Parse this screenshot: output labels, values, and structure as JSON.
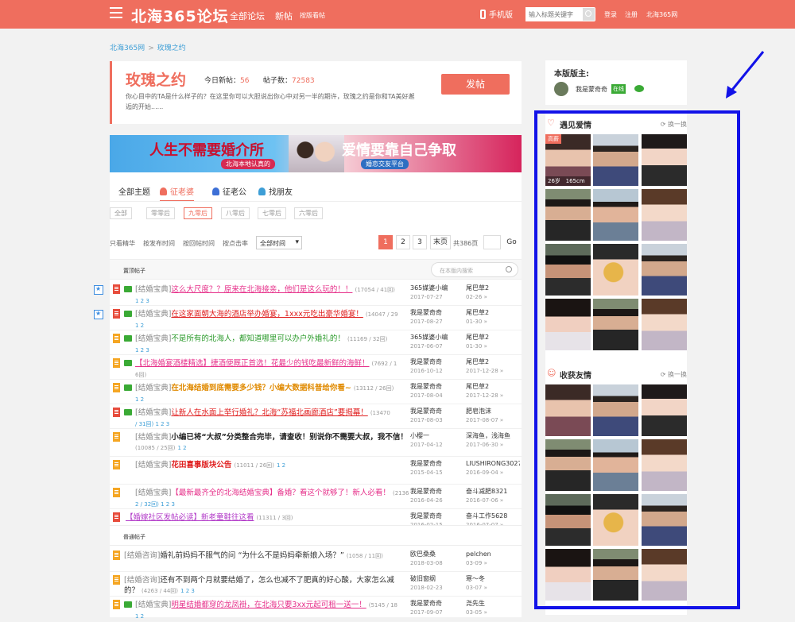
{
  "header": {
    "logo": "北海365论坛",
    "nav": [
      "全部论坛",
      "新帖",
      "按版看帖"
    ],
    "mobile": "手机版",
    "search_placeholder": "输入标题关键字",
    "login": "登录",
    "register": "注册",
    "site": "北海365网"
  },
  "breadcrumb": [
    "北海365网",
    "玫瑰之约"
  ],
  "forum": {
    "title": "玫瑰之约",
    "today_label": "今日新帖：",
    "today_value": "56",
    "posts_label": "帖子数：",
    "posts_value": "72583",
    "desc": "你心目中的TA是什么样子的？在这里你可以大胆说出你心中对另一半的期许，玫瑰之约是你和TA美好邂逅的开始......",
    "post_button": "发帖"
  },
  "banner": {
    "left": "人生不需要婚介所",
    "right": "爱情要靠自己争取",
    "sub_left": "北海本地认真的",
    "sub_right": "婚恋交友平台"
  },
  "tabs": [
    "全部主题",
    "征老婆",
    "征老公",
    "找朋友"
  ],
  "age_filters": [
    "全部",
    "零零后",
    "九零后",
    "八零后",
    "七零后",
    "六零后"
  ],
  "sort": {
    "links": [
      "只看精华",
      "按发布时间",
      "按回帖时间",
      "按点击率"
    ],
    "select": "全部时间"
  },
  "pagination": {
    "pages": [
      "1",
      "2",
      "3",
      "末页"
    ],
    "total": "共386页",
    "go": "Go"
  },
  "pinned_section": {
    "title": "置顶帖子",
    "search_placeholder": "在本版内搜索"
  },
  "normal_section": {
    "title": "普通帖子"
  },
  "pinned_threads": [
    {
      "cat": "[结婚宝典]",
      "text": "这么大尺度？？原来在北海接亲，他们是这么玩的！！",
      "count": "(17054 / 41回)",
      "pages": "1 2 3",
      "author": "365媒婆小编",
      "date": "2017-07-27",
      "last": "尾巴草2",
      "last_date": "02-26 »"
    },
    {
      "cat": "[结婚宝典]",
      "text": "在这家面朝大海的酒店举办婚宴，1xxx元吃出豪华婚宴！",
      "count": "(14047 / 29",
      "pages": "1 2",
      "author": "我是蒙奇奇",
      "date": "2017-08-27",
      "last": "尾巴草2",
      "last_date": "01-30 »"
    },
    {
      "cat": "[结婚宝典]",
      "text": "不是所有的北海人，都知道哪里可以办户外婚礼的！",
      "count": "(11169 / 32回)",
      "pages": "1 2 3",
      "author": "365媒婆小编",
      "date": "2017-06-07",
      "last": "尾巴草2",
      "last_date": "01-30 »"
    },
    {
      "cat": "",
      "text": "【北海婚宴酒楼精选】捷酒便厩正首选！花最少的钱吃最新鲜的海鲜！",
      "count": "(7692 / 1",
      "pages": "6回)",
      "author": "我是蒙奇奇",
      "date": "2016-10-12",
      "last": "尾巴草2",
      "last_date": "2017-12-28 »"
    },
    {
      "cat": "[结婚宝典]",
      "text": "在北海结婚到底需要多少钱？小编大数据科普给你看~",
      "count": "(13112 / 26回)",
      "pages": "1 2",
      "author": "我是蒙奇奇",
      "date": "2017-08-04",
      "last": "尾巴草2",
      "last_date": "2017-12-28 »"
    },
    {
      "cat": "[结婚宝典]",
      "text": "让新人在水面上举行婚礼？北海“苏福北画廊酒店”要揭幕！",
      "count": "(13470",
      "pages": "/ 31回) 1 2 3",
      "author": "我是蒙奇奇",
      "date": "2017-08-03",
      "last": "肥皂泡沫",
      "last_date": "2017-08-07 »"
    },
    {
      "cat": "[结婚宝典]",
      "text": "小编已将“大叔”分类整合完毕，请查收！别说你不需要大叔，我不信！",
      "count": "(10085 / 25回)",
      "pages": "1 2",
      "author": "小樱一",
      "date": "2017-04-12",
      "last": "深海鱼，浅海鱼",
      "last_date": "2017-06-30 »"
    },
    {
      "cat": "[结婚宝典]",
      "text": "花田喜事版块公告",
      "count": "(11011 / 26回)",
      "pages": "1 2",
      "author": "我是蒙奇奇",
      "date": "2015-04-15",
      "last": "LIUSHIRONG3027",
      "last_date": "2016-09-04 »"
    },
    {
      "cat": "[结婚宝典]",
      "text": "【最新最齐全的北海结婚宝典】备婚？看这个就够了！新人必看！",
      "count": "(2136",
      "pages": "2 / 32回) 1 2 3",
      "author": "我是蒙奇奇",
      "date": "2016-04-26",
      "last": "奋斗减肥8321",
      "last_date": "2016-07-06 »"
    },
    {
      "cat": "",
      "text": "【婚嫁社区发帖必读】新老童鞋往这看",
      "count": "(11311 / 3回)",
      "pages": "",
      "author": "我是蒙奇奇",
      "date": "2016-02-15",
      "last": "奋斗工作5628",
      "last_date": "2016-07-07 »"
    }
  ],
  "normal_threads": [
    {
      "cat": "[结婚咨询]",
      "text": "婚礼前妈妈不服气的问 “为什么不是妈妈牵新娘入场？”",
      "count": "(1058 / 11回)",
      "pages": "",
      "author": "欧巴桑桑",
      "date": "2018-03-08",
      "last": "pelchen",
      "last_date": "03-09 »"
    },
    {
      "cat": "[结婚咨询]",
      "text": "还有不到两个月就要结婚了，怎么也减不了肥真的好心酸，大家怎么减的？",
      "count": "(4263 / 44回)",
      "pages": "1 2 3",
      "author": "破旧窗纲",
      "date": "2018-02-23",
      "last": "寒～冬",
      "last_date": "03-07 »"
    },
    {
      "cat": "[结婚宝典]",
      "text": "明星结婚都穿的龙凤褂，在北海只要3xx元起可租一送一！",
      "count": "(5145 / 18",
      "pages": "1 2",
      "author": "我是蒙奇奇",
      "date": "2017-09-07",
      "last": "尧先生",
      "last_date": "03-05 »"
    }
  ],
  "sidebar": {
    "moderators_title": "本版版主:",
    "moderator_name": "我是蒙奇奇",
    "online": "在线",
    "section1_title": "遇见爱情",
    "section2_title": "收获友情",
    "refresh": "换一换",
    "featured_tag": "高薪",
    "featured_age": "26岁",
    "featured_height": "165cm"
  },
  "colors": {
    "brand": "#ef6e5e",
    "link": "#3d9ed6",
    "annotation": "#1212e8"
  }
}
